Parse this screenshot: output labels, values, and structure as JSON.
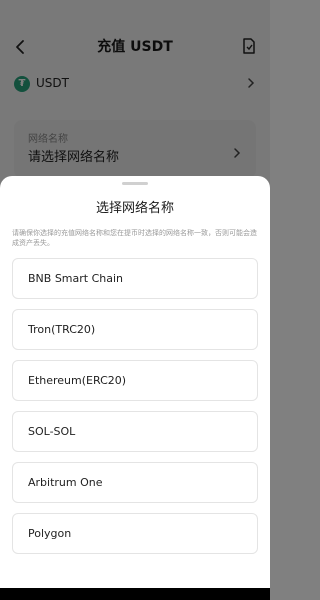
{
  "header": {
    "title": "充值 USDT"
  },
  "coin": {
    "symbol_glyph": "₮",
    "label": "USDT",
    "brand_color": "#26a17b"
  },
  "network_field": {
    "label": "网络名称",
    "placeholder": "请选择网络名称"
  },
  "sheet": {
    "title": "选择网络名称",
    "warning": "请确保你选择的充值网络名称和您在提币时选择的网络名称一致，否则可能会造成资产丢失。",
    "options": [
      {
        "label": "BNB Smart Chain"
      },
      {
        "label": "Tron(TRC20)"
      },
      {
        "label": "Ethereum(ERC20)"
      },
      {
        "label": "SOL-SOL"
      },
      {
        "label": "Arbitrum One"
      },
      {
        "label": "Polygon"
      }
    ]
  }
}
